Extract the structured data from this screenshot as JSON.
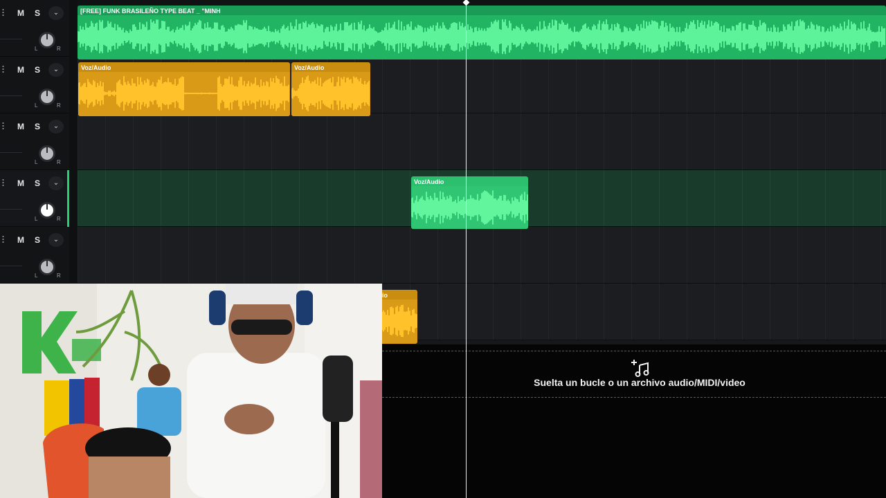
{
  "tracks": [
    {
      "mute_label": "M",
      "solo_label": "S",
      "pan_left": "L",
      "pan_right": "R"
    },
    {
      "mute_label": "M",
      "solo_label": "S",
      "pan_left": "L",
      "pan_right": "R"
    },
    {
      "mute_label": "M",
      "solo_label": "S",
      "pan_left": "L",
      "pan_right": "R"
    },
    {
      "mute_label": "M",
      "solo_label": "S",
      "pan_left": "L",
      "pan_right": "R",
      "selected": true
    },
    {
      "mute_label": "M",
      "solo_label": "S",
      "pan_left": "L",
      "pan_right": "R"
    }
  ],
  "clips": {
    "beat": {
      "title": "[FREE] FUNK BRASILEÑO TYPE BEAT _ \"MINH",
      "color": "#20b463"
    },
    "voz1": {
      "title": "Voz/Audio",
      "color": "#d89a17"
    },
    "voz2": {
      "title": "Voz/Audio",
      "color": "#d89a17"
    },
    "voz3": {
      "title": "Voz/Audio",
      "color": "#2fc572"
    },
    "voz4": {
      "title": "io",
      "color": "#d89a17"
    }
  },
  "dropzone": {
    "icon": "music-note-plus-icon",
    "text": "Suelta un bucle o un archivo audio/MIDI/video"
  },
  "colors": {
    "accent_green": "#23d36f",
    "clip_green": "#20b463",
    "clip_orange": "#d89a17",
    "background": "#16181b"
  }
}
